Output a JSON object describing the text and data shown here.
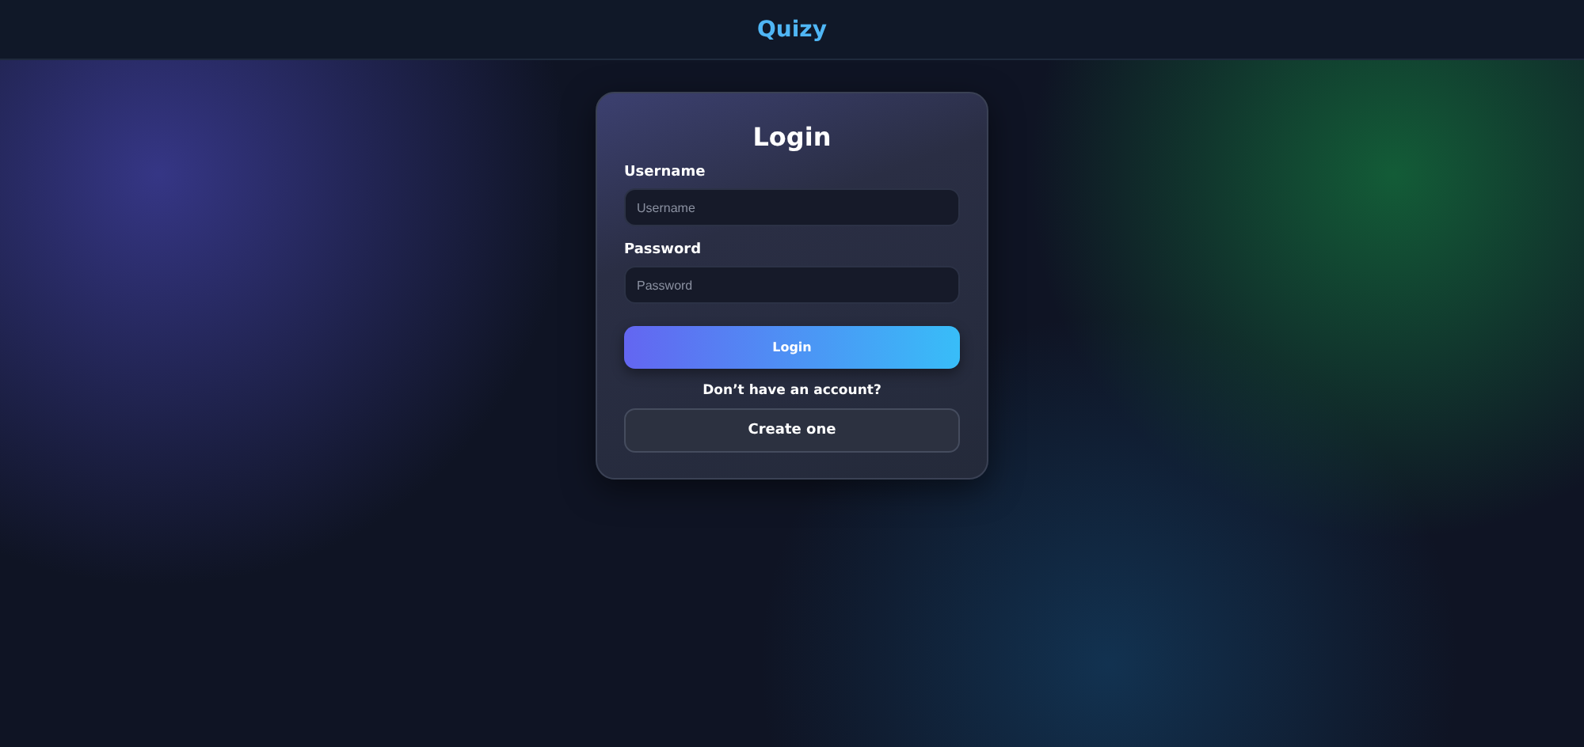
{
  "header": {
    "brand": "Quizy"
  },
  "login_card": {
    "title": "Login",
    "fields": [
      {
        "label": "Username",
        "placeholder": "Username"
      },
      {
        "label": "Password",
        "placeholder": "Password"
      }
    ],
    "submit": "Login",
    "prompt": "Don’t have an account?",
    "secondary": "Create one"
  }
}
